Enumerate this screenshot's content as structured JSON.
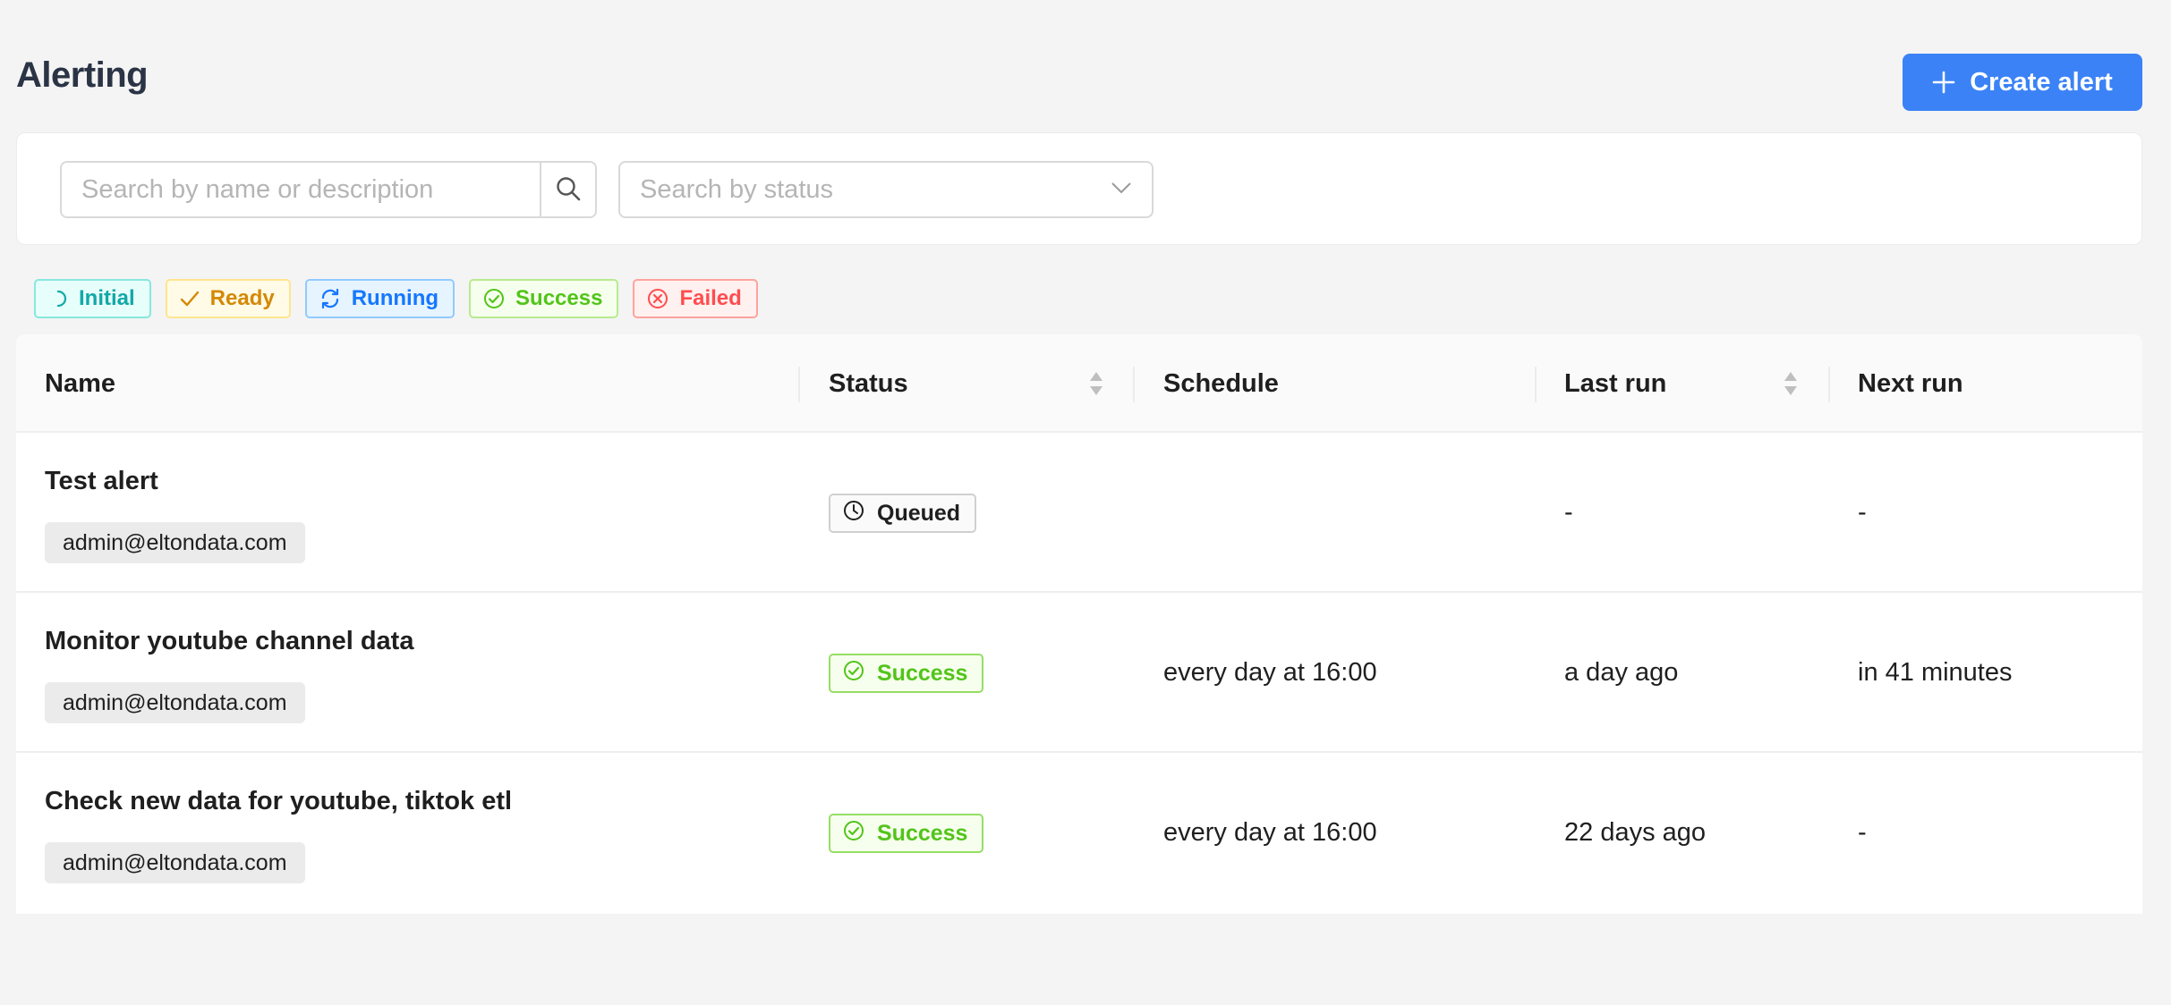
{
  "page": {
    "title": "Alerting",
    "create_button_label": "Create alert"
  },
  "filters": {
    "search_placeholder": "Search by name or description",
    "status_placeholder": "Search by status"
  },
  "legend": [
    {
      "label": "Initial",
      "icon": "spinner-icon",
      "color": "#13a8a8",
      "bg": "#e6fffb",
      "border": "#87e8de"
    },
    {
      "label": "Ready",
      "icon": "check-icon",
      "color": "#d48806",
      "bg": "#fffbe6",
      "border": "#ffe58f"
    },
    {
      "label": "Running",
      "icon": "sync-icon",
      "color": "#1677ff",
      "bg": "#e6f4ff",
      "border": "#91caff"
    },
    {
      "label": "Success",
      "icon": "check-circle-icon",
      "color": "#52c41a",
      "bg": "#f6ffed",
      "border": "#b7eb8f"
    },
    {
      "label": "Failed",
      "icon": "close-circle-icon",
      "color": "#ff4d4f",
      "bg": "#fff1f0",
      "border": "#ffa39e"
    }
  ],
  "table": {
    "columns": {
      "name": "Name",
      "status": "Status",
      "schedule": "Schedule",
      "last_run": "Last run",
      "next_run": "Next run"
    },
    "rows": [
      {
        "name": "Test alert",
        "owner": "admin@eltondata.com",
        "status": "Queued",
        "status_icon": "clock-icon",
        "schedule": "",
        "last_run": "-",
        "next_run": "-"
      },
      {
        "name": "Monitor youtube channel data",
        "owner": "admin@eltondata.com",
        "status": "Success",
        "status_icon": "check-circle-icon",
        "schedule": "every day at 16:00",
        "last_run": "a day ago",
        "next_run": "in 41 minutes"
      },
      {
        "name": "Check new data for youtube, tiktok etl",
        "owner": "admin@eltondata.com",
        "status": "Success",
        "status_icon": "check-circle-icon",
        "schedule": "every day at 16:00",
        "last_run": "22 days ago",
        "next_run": "-"
      }
    ]
  },
  "colors": {
    "primary": "#3b82f6",
    "success": "#52c41a",
    "background": "#f4f4f4"
  }
}
